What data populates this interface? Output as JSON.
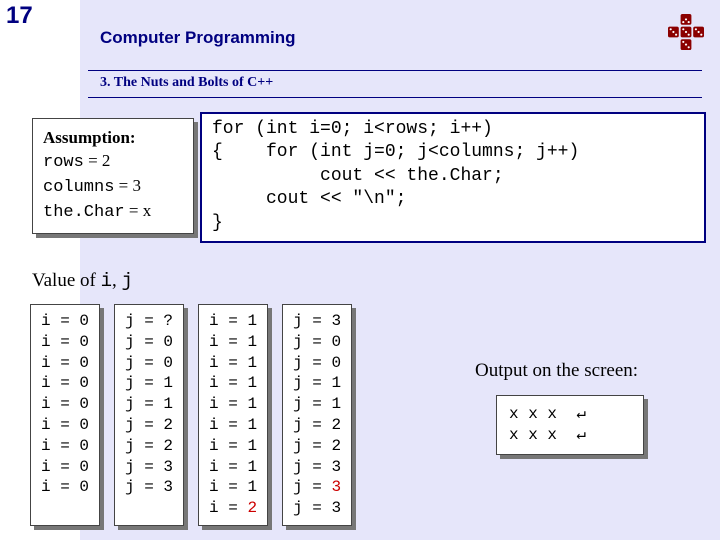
{
  "slide_number": "17",
  "header_title": "Computer Programming",
  "subtitle": "3. The Nuts and Bolts of C++",
  "assumption": {
    "heading": "Assumption:",
    "rows_label": "rows",
    "rows_val": "= 2",
    "cols_label": "columns",
    "cols_val": "= 3",
    "char_label": "the.Char",
    "char_val": "= x"
  },
  "code": "for (int i=0; i<rows; i++)\n{    for (int j=0; j<columns; j++)\n          cout << the.Char;\n     cout << \"\\n\";\n}",
  "valueof_prefix": "Value of ",
  "valueof_i": "i",
  "valueof_sep": ", ",
  "valueof_j": "j",
  "trace": {
    "col1": "i = 0\ni = 0\ni = 0\ni = 0\ni = 0\ni = 0\ni = 0\ni = 0\ni = 0",
    "col2": "j = ?\nj = 0\nj = 0\nj = 1\nj = 1\nj = 2\nj = 2\nj = 3\nj = 3",
    "col3_pre": "i = 1\ni = 1\ni = 1\ni = 1\ni = 1\ni = 1\ni = 1\ni = 1\ni = 1\ni = ",
    "col3_red": "2",
    "col4_a": "j = 3\nj = 0\nj = 0\nj = 1\nj = 1\nj = 2\nj = 2\nj = 3\nj = ",
    "col4_red": "3",
    "col4_b": "\nj = 3"
  },
  "output_label": "Output on the screen:",
  "output_text": "x x x  ↵\nx x x  ↵"
}
